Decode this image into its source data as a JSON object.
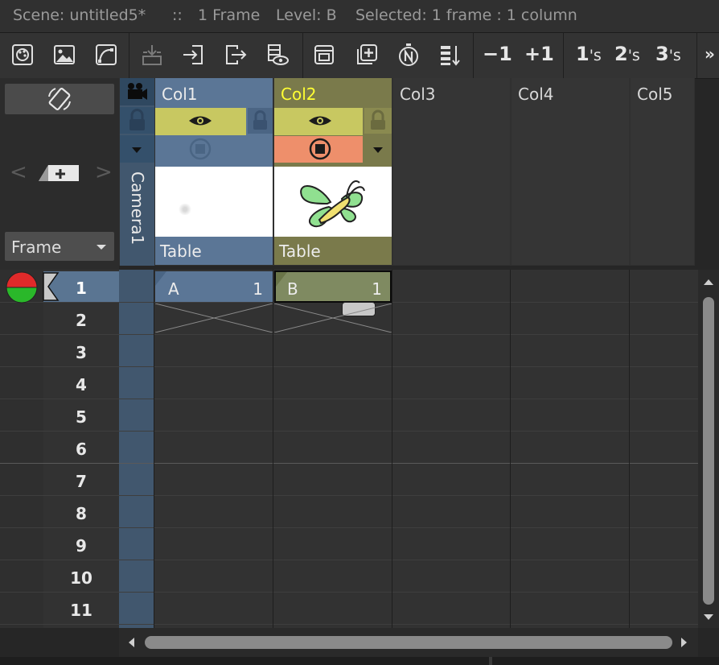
{
  "status": {
    "scene": "Scene: untitled5*",
    "sep": "::",
    "frames": "1 Frame",
    "level": "Level: B",
    "selected": "Selected: 1 frame : 1 column"
  },
  "toolbar": {
    "minus_one": "−1",
    "plus_one": "+1",
    "ones": "1",
    "twos": "2",
    "threes": "3",
    "s": "'s",
    "more": "»"
  },
  "left_panel": {
    "frame_dropdown": "Frame"
  },
  "camera": {
    "label": "Camera1"
  },
  "columns": [
    {
      "name": "Col1",
      "level": "Table",
      "cell_level": "A",
      "cell_frame": "1"
    },
    {
      "name": "Col2",
      "level": "Table",
      "cell_level": "B",
      "cell_frame": "1"
    },
    {
      "name": "Col3"
    },
    {
      "name": "Col4"
    },
    {
      "name": "Col5"
    }
  ],
  "rows": [
    "1",
    "2",
    "3",
    "4",
    "5",
    "6",
    "7",
    "8",
    "9",
    "10",
    "11"
  ],
  "colors": {
    "col1": "#5d7896",
    "col2": "#7a7a4a",
    "col2_name": "#ffff33",
    "eye_yellow": "#c8c860",
    "col2_lock": "#8a8a50",
    "col2_preview": "#ee8f6b",
    "camera_col": "#41576e",
    "active_row": "#5a7592"
  }
}
